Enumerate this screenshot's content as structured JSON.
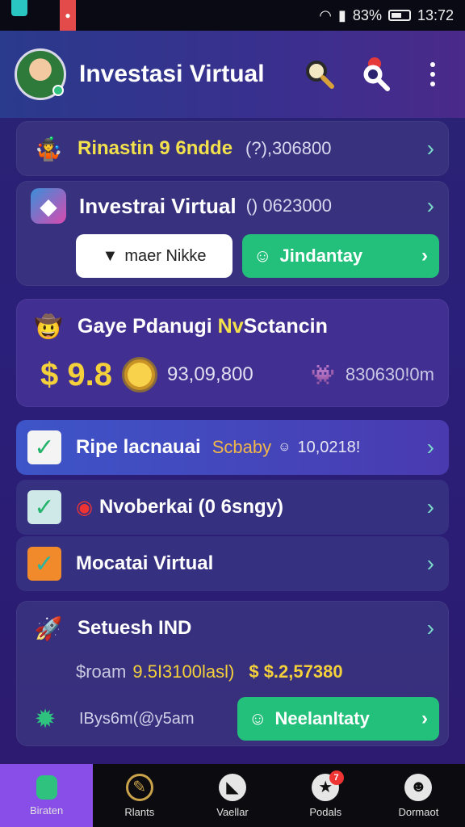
{
  "status_bar": {
    "battery": "83%",
    "time": "13:72"
  },
  "header": {
    "title": "Investasi Virtual"
  },
  "card1": {
    "title": "Rinastin 9 6ndde",
    "amount": "(?),306800"
  },
  "card2": {
    "title": "Investrai Virtual",
    "amount": "() 0623000",
    "btn_left": "maer Nikke",
    "btn_right": "Jindantay"
  },
  "card3": {
    "title_a": "Gaye Pdanugi ",
    "title_b": "Nv",
    "title_c": "Sctancin",
    "big_value": "$ 9.8",
    "mid_value": "93,09,800",
    "right_value": "830630!0m"
  },
  "rows": [
    {
      "label": "Ripe lacnauai",
      "label2": "Scbaby",
      "value": "10,0218!"
    },
    {
      "label": "Nvoberkai (0 6sngy)"
    },
    {
      "label": "Mocatai Virtual"
    }
  ],
  "card4": {
    "title": "Setuesh IND",
    "line_a": "$roam",
    "line_b": "9.5I3100lasl)",
    "line_c": "$ $.2,57380",
    "row3_label": "IBys6m(@y5am",
    "btn": "Neelanltaty"
  },
  "bottom_nav": [
    {
      "label": "Biraten",
      "active": true
    },
    {
      "label": "Rlants"
    },
    {
      "label": "Vaellar"
    },
    {
      "label": "Podals",
      "badge": "7"
    },
    {
      "label": "Dormaot"
    }
  ]
}
